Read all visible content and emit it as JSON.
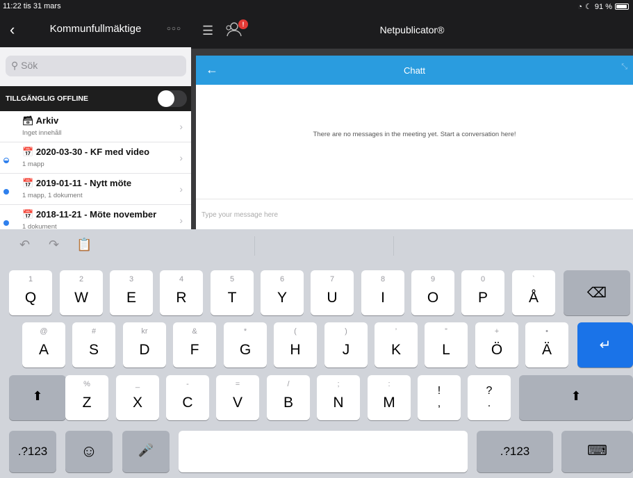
{
  "status": {
    "time": "11:22",
    "date": "tis 31 mars",
    "battery": "91 %"
  },
  "left": {
    "back": "‹",
    "title": "Kommunfullmäktige",
    "more": "○○○",
    "search_placeholder": "Sök",
    "offline_label": "TILLGÄNGLIG OFFLINE",
    "items": [
      {
        "icon": "🗃",
        "title": "Arkiv",
        "subtitle": "Inget innehåll"
      },
      {
        "icon": "📅",
        "title": "2020-03-30 - KF med video",
        "subtitle": "1 mapp"
      },
      {
        "icon": "📅",
        "title": "2019-01-11 - Nytt möte",
        "subtitle": "1 mapp, 1 dokument"
      },
      {
        "icon": "📅",
        "title": "2018-11-21 - Möte november",
        "subtitle": "1 dokument"
      }
    ]
  },
  "topbar": {
    "brand": "Netpublicator®",
    "badge": "!"
  },
  "chat": {
    "title": "Chatt",
    "empty": "There are no messages in the meeting yet. Start a conversation here!",
    "input_placeholder": "Type your message here"
  },
  "keyboard": {
    "row1": [
      {
        "sec": "1",
        "pri": "Q"
      },
      {
        "sec": "2",
        "pri": "W"
      },
      {
        "sec": "3",
        "pri": "E"
      },
      {
        "sec": "4",
        "pri": "R"
      },
      {
        "sec": "5",
        "pri": "T"
      },
      {
        "sec": "6",
        "pri": "Y"
      },
      {
        "sec": "7",
        "pri": "U"
      },
      {
        "sec": "8",
        "pri": "I"
      },
      {
        "sec": "9",
        "pri": "O"
      },
      {
        "sec": "0",
        "pri": "P"
      },
      {
        "sec": "`",
        "pri": "Å"
      }
    ],
    "row2": [
      {
        "sec": "@",
        "pri": "A"
      },
      {
        "sec": "#",
        "pri": "S"
      },
      {
        "sec": "kr",
        "pri": "D"
      },
      {
        "sec": "&",
        "pri": "F"
      },
      {
        "sec": "*",
        "pri": "G"
      },
      {
        "sec": "(",
        "pri": "H"
      },
      {
        "sec": ")",
        "pri": "J"
      },
      {
        "sec": "’",
        "pri": "K"
      },
      {
        "sec": "”",
        "pri": "L"
      },
      {
        "sec": "+",
        "pri": "Ö"
      },
      {
        "sec": "•",
        "pri": "Ä"
      }
    ],
    "row3": [
      {
        "sec": "%",
        "pri": "Z"
      },
      {
        "sec": "_",
        "pri": "X"
      },
      {
        "sec": "-",
        "pri": "C"
      },
      {
        "sec": "=",
        "pri": "V"
      },
      {
        "sec": "/",
        "pri": "B"
      },
      {
        "sec": ";",
        "pri": "N"
      },
      {
        "sec": ":",
        "pri": "M"
      },
      {
        "sec": "!",
        "pri": ","
      },
      {
        "sec": "?",
        "pri": "."
      }
    ],
    "num_label": ".?123",
    "icons": {
      "delete": "⌫",
      "return": "↵",
      "shift": "⬆",
      "emoji": "☺",
      "mic": "🎤",
      "hide": "⌨",
      "undo": "↶",
      "redo": "↷",
      "paste": "📋"
    }
  }
}
